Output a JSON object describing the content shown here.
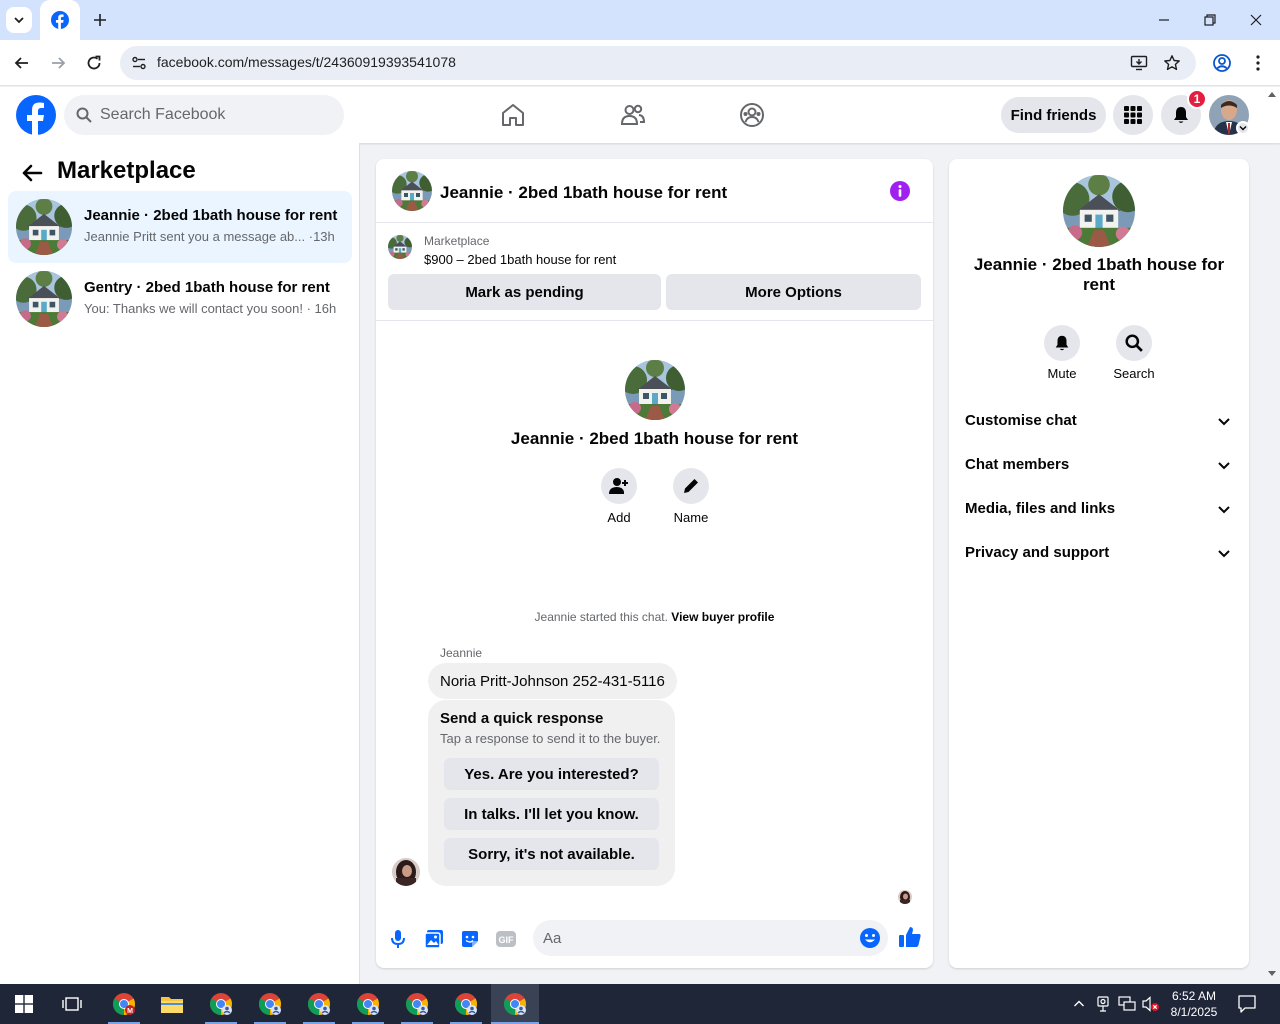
{
  "browser": {
    "url": "facebook.com/messages/t/24360919393541078"
  },
  "header": {
    "search_placeholder": "Search Facebook",
    "find_friends": "Find friends",
    "notification_count": "1"
  },
  "left_panel": {
    "title": "Marketplace",
    "conversations": [
      {
        "title": "Jeannie · 2bed 1bath house for rent",
        "snippet": "Jeannie Pritt sent you a message ab... ·13h",
        "active": true
      },
      {
        "title": "Gentry · 2bed 1bath house for rent",
        "snippet": "You: Thanks we will contact you soon! · 16h",
        "active": false
      }
    ]
  },
  "chat": {
    "title": "Jeannie · 2bed 1bath house for rent",
    "marketplace_label": "Marketplace",
    "listing": "$900 – 2bed 1bath house for rent",
    "mark_pending": "Mark as pending",
    "more_options": "More Options",
    "intro_title": "Jeannie · 2bed 1bath house for rent",
    "intro_actions": {
      "add": "Add",
      "name": "Name"
    },
    "started_text": "Jeannie started this chat.",
    "view_profile": "View buyer profile",
    "sender": "Jeannie",
    "message": "Noria Pritt-Johnson 252-431-5116",
    "quick_response": {
      "title": "Send a quick response",
      "subtitle": "Tap a response to send it to the buyer.",
      "options": [
        "Yes. Are you interested?",
        "In talks. I'll let you know.",
        "Sorry, it's not available."
      ]
    },
    "composer_placeholder": "Aa"
  },
  "right_panel": {
    "title": "Jeannie · 2bed 1bath house for rent",
    "actions": {
      "mute": "Mute",
      "search": "Search"
    },
    "sections": [
      "Customise chat",
      "Chat members",
      "Media, files and links",
      "Privacy and support"
    ]
  },
  "taskbar": {
    "time": "6:52 AM",
    "date": "8/1/2025"
  },
  "colors": {
    "fb_blue": "#0866ff",
    "active_bg": "#ebf5ff",
    "badge_red": "#e41e3f",
    "info_purple": "#a020f0"
  }
}
